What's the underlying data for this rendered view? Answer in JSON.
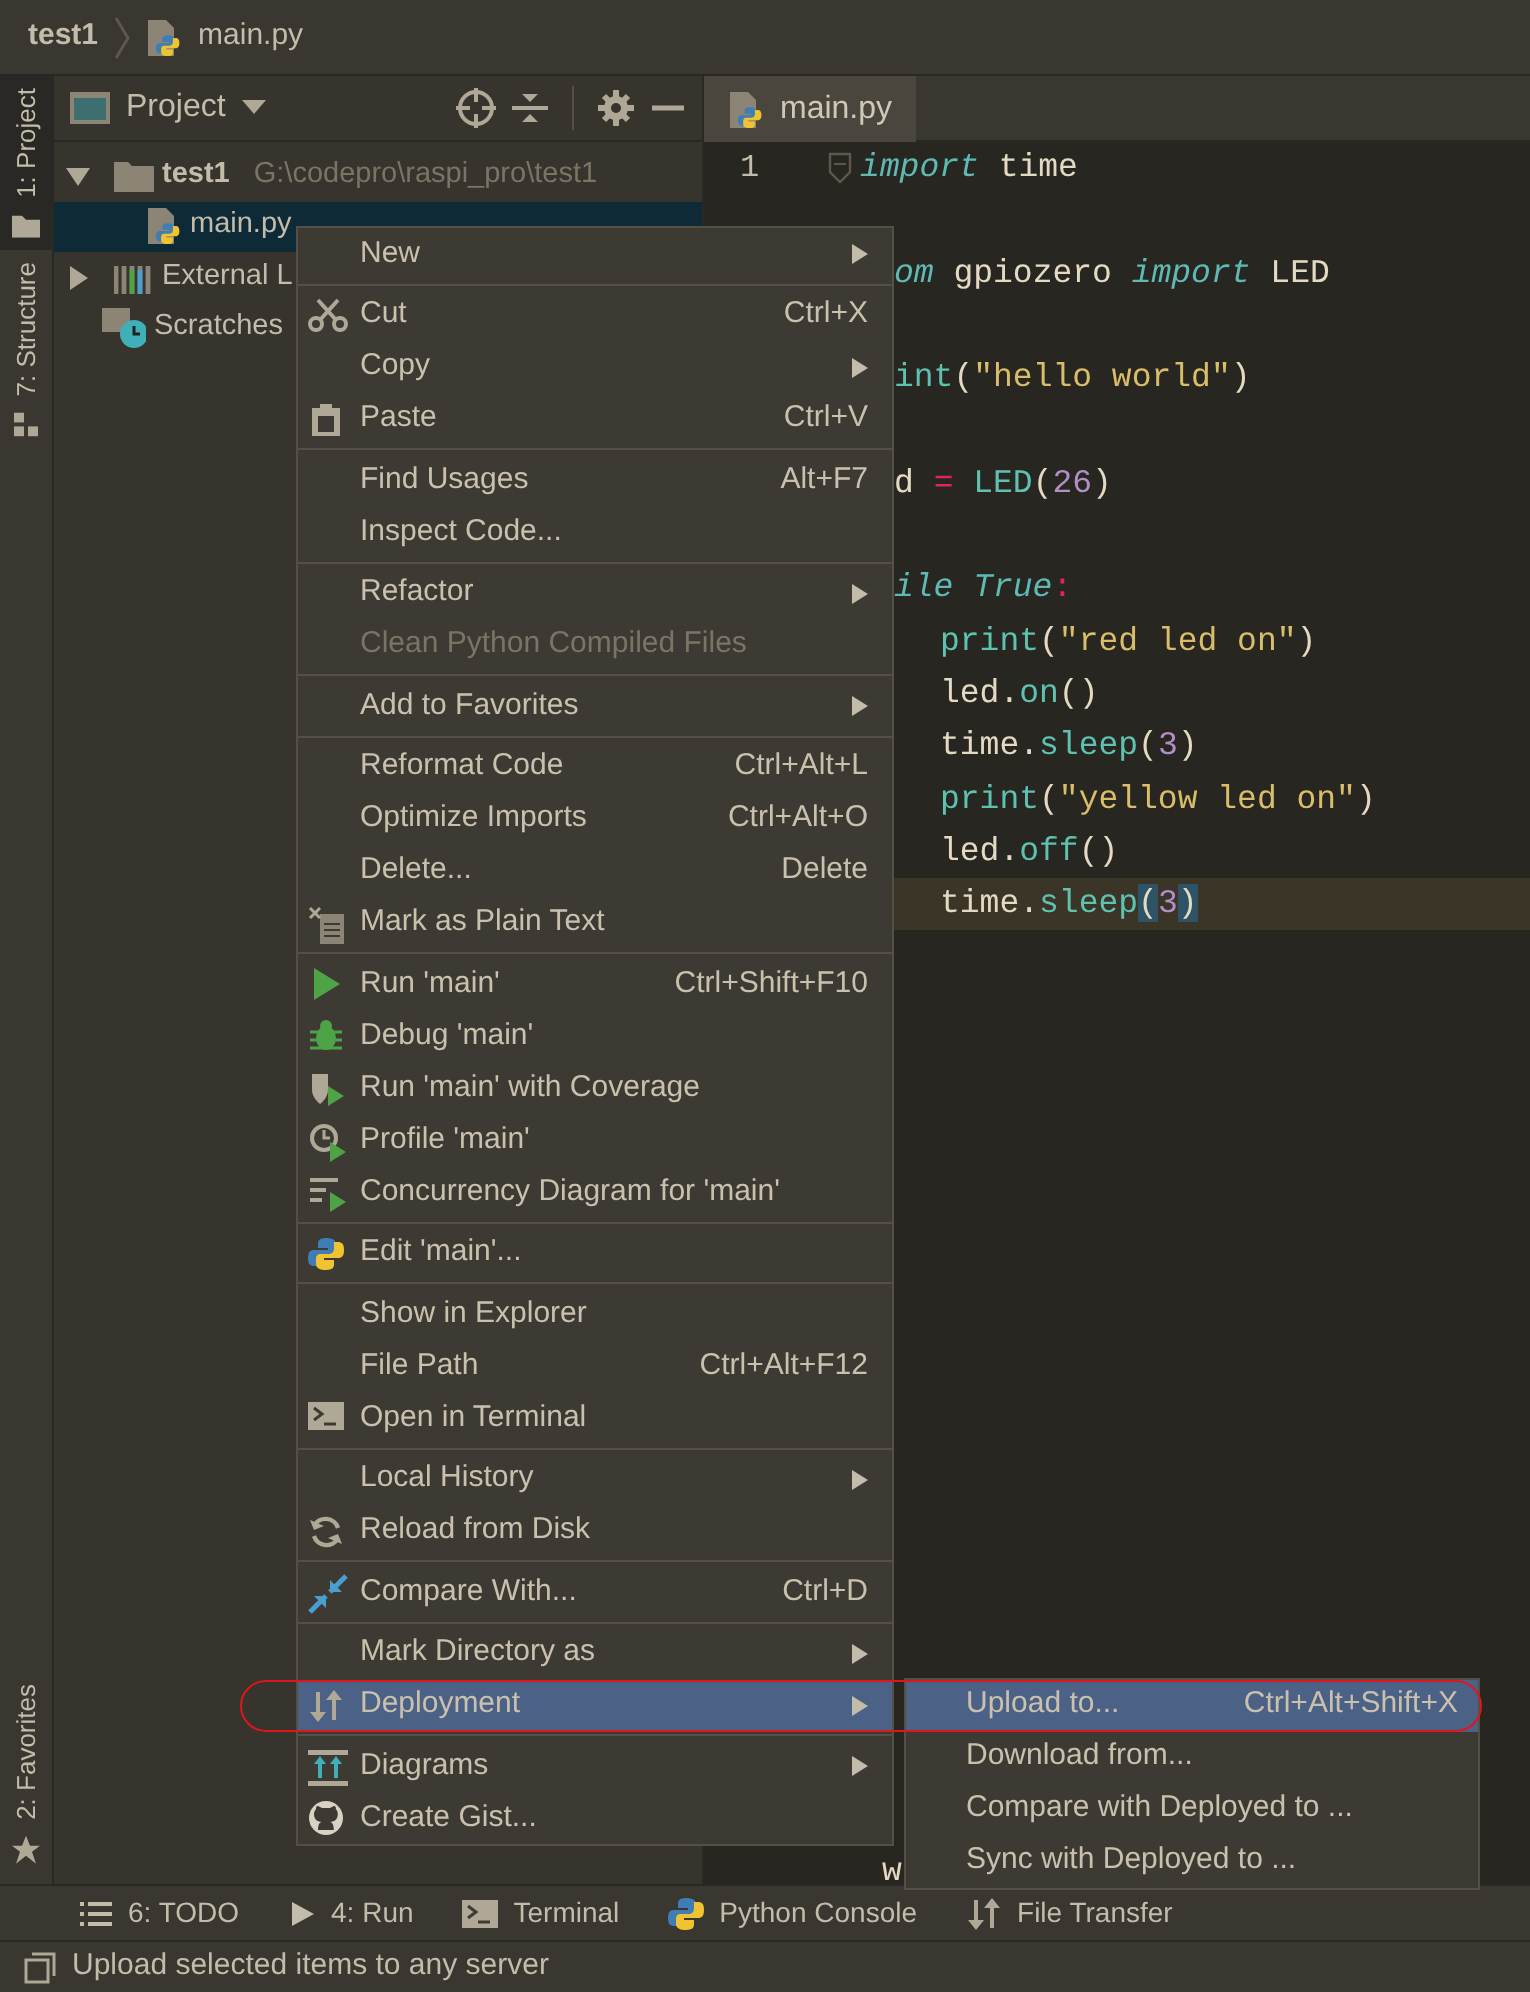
{
  "breadcrumb": {
    "project": "test1",
    "file": "main.py"
  },
  "tool_stripe": {
    "top": [
      {
        "label": "1: Project",
        "kind": "folder",
        "selected": true
      },
      {
        "label": "7: Structure",
        "kind": "structure",
        "selected": false
      }
    ],
    "bottom": [
      {
        "label": "2: Favorites",
        "kind": "star",
        "selected": false
      }
    ]
  },
  "project_panel": {
    "title": "Project",
    "tree": [
      {
        "label": "test1",
        "path": "G:\\codepro\\raspi_pro\\test1",
        "kind": "folder",
        "expanded": true,
        "selected": false,
        "children": [
          {
            "label": "main.py",
            "kind": "python_file",
            "selected": true
          }
        ]
      },
      {
        "label": "External L",
        "kind": "library",
        "expanded": false,
        "selected": false
      },
      {
        "label": "Scratches",
        "kind": "scratches",
        "selected": false
      }
    ]
  },
  "editor": {
    "tabs": [
      {
        "label": "main.py",
        "selected": true
      }
    ],
    "line_numbers": [
      "1"
    ],
    "lines": [
      {
        "kind": "full",
        "current": false,
        "tokens": [
          {
            "text": "import",
            "kind": "kw"
          },
          {
            "text": " time",
            "kind": "plain"
          }
        ]
      },
      {
        "kind": "cut",
        "current": false,
        "tokens": [
          {
            "text": "om",
            "kind": "kw"
          },
          {
            "text": " gpiozero ",
            "kind": "plain"
          },
          {
            "text": "import",
            "kind": "kw"
          },
          {
            "text": " LED",
            "kind": "plain"
          }
        ]
      },
      {
        "kind": "cut",
        "current": false,
        "tokens": [
          {
            "text": "int",
            "kind": "fn"
          },
          {
            "text": "(",
            "kind": "plain"
          },
          {
            "text": "\"hello world\"",
            "kind": "str"
          },
          {
            "text": ")",
            "kind": "plain"
          }
        ]
      },
      {
        "kind": "cut",
        "current": false,
        "tokens": [
          {
            "text": "d ",
            "kind": "plain"
          },
          {
            "text": "=",
            "kind": "op"
          },
          {
            "text": " LED",
            "kind": "fn"
          },
          {
            "text": "(",
            "kind": "plain"
          },
          {
            "text": "26",
            "kind": "num"
          },
          {
            "text": ")",
            "kind": "plain"
          }
        ]
      },
      {
        "kind": "cut",
        "current": false,
        "tokens": [
          {
            "text": "ile True",
            "kind": "kw"
          },
          {
            "text": ":",
            "kind": "op"
          }
        ]
      },
      {
        "kind": "indented",
        "current": false,
        "tokens": [
          {
            "text": "print",
            "kind": "fn"
          },
          {
            "text": "(",
            "kind": "plain"
          },
          {
            "text": "\"red led on\"",
            "kind": "str"
          },
          {
            "text": ")",
            "kind": "plain"
          }
        ]
      },
      {
        "kind": "indented",
        "current": false,
        "tokens": [
          {
            "text": "led.",
            "kind": "plain"
          },
          {
            "text": "on",
            "kind": "fn"
          },
          {
            "text": "()",
            "kind": "plain"
          }
        ]
      },
      {
        "kind": "indented",
        "current": false,
        "tokens": [
          {
            "text": "time.",
            "kind": "plain"
          },
          {
            "text": "sleep",
            "kind": "fn"
          },
          {
            "text": "(",
            "kind": "plain"
          },
          {
            "text": "3",
            "kind": "num"
          },
          {
            "text": ")",
            "kind": "plain"
          }
        ]
      },
      {
        "kind": "indented",
        "current": false,
        "tokens": [
          {
            "text": "print",
            "kind": "fn"
          },
          {
            "text": "(",
            "kind": "plain"
          },
          {
            "text": "\"yellow led on\"",
            "kind": "str"
          },
          {
            "text": ")",
            "kind": "plain"
          }
        ]
      },
      {
        "kind": "indented",
        "current": false,
        "tokens": [
          {
            "text": "led.",
            "kind": "plain"
          },
          {
            "text": "off",
            "kind": "fn"
          },
          {
            "text": "()",
            "kind": "plain"
          }
        ]
      },
      {
        "kind": "indented",
        "current": true,
        "tokens": [
          {
            "text": "time.",
            "kind": "plain"
          },
          {
            "text": "sleep",
            "kind": "fn"
          },
          {
            "text": "(",
            "kind": "match"
          },
          {
            "text": "3",
            "kind": "num"
          },
          {
            "text": ")",
            "kind": "match"
          }
        ]
      },
      {
        "kind": "cut",
        "current": false,
        "tokens": [
          {
            "text": "w",
            "kind": "plain"
          }
        ]
      }
    ]
  },
  "context_menu": {
    "groups": [
      {
        "items": [
          {
            "label": "New",
            "submenu": true,
            "disabled": false,
            "selected": false
          }
        ]
      },
      {
        "items": [
          {
            "label": "Cut",
            "kind": "scissors",
            "shortcut": "Ctrl+X",
            "submenu": false,
            "disabled": false,
            "selected": false
          },
          {
            "label": "Copy",
            "submenu": true,
            "disabled": false,
            "selected": false
          },
          {
            "label": "Paste",
            "kind": "clipboard",
            "shortcut": "Ctrl+V",
            "submenu": false,
            "disabled": false,
            "selected": false
          }
        ]
      },
      {
        "items": [
          {
            "label": "Find Usages",
            "shortcut": "Alt+F7",
            "submenu": false,
            "disabled": false,
            "selected": false
          },
          {
            "label": "Inspect Code...",
            "submenu": false,
            "disabled": false,
            "selected": false
          }
        ]
      },
      {
        "items": [
          {
            "label": "Refactor",
            "submenu": true,
            "disabled": false,
            "selected": false
          },
          {
            "label": "Clean Python Compiled Files",
            "submenu": false,
            "disabled": true,
            "selected": false
          }
        ]
      },
      {
        "items": [
          {
            "label": "Add to Favorites",
            "submenu": true,
            "disabled": false,
            "selected": false
          }
        ]
      },
      {
        "items": [
          {
            "label": "Reformat Code",
            "shortcut": "Ctrl+Alt+L",
            "submenu": false,
            "disabled": false,
            "selected": false
          },
          {
            "label": "Optimize Imports",
            "shortcut": "Ctrl+Alt+O",
            "submenu": false,
            "disabled": false,
            "selected": false
          },
          {
            "label": "Delete...",
            "shortcut": "Delete",
            "submenu": false,
            "disabled": false,
            "selected": false
          },
          {
            "label": "Mark as Plain Text",
            "kind": "document",
            "submenu": false,
            "disabled": false,
            "selected": false
          }
        ]
      },
      {
        "items": [
          {
            "label": "Run 'main'",
            "kind": "run",
            "shortcut": "Ctrl+Shift+F10",
            "submenu": false,
            "disabled": false,
            "selected": false
          },
          {
            "label": "Debug 'main'",
            "kind": "bug",
            "submenu": false,
            "disabled": false,
            "selected": false
          },
          {
            "label": "Run 'main' with Coverage",
            "kind": "coverage",
            "submenu": false,
            "disabled": false,
            "selected": false
          },
          {
            "label": "Profile 'main'",
            "kind": "profile",
            "submenu": false,
            "disabled": false,
            "selected": false
          },
          {
            "label": "Concurrency Diagram for 'main'",
            "kind": "concurrency",
            "submenu": false,
            "disabled": false,
            "selected": false
          }
        ]
      },
      {
        "items": [
          {
            "label": "Edit 'main'...",
            "kind": "python",
            "submenu": false,
            "disabled": false,
            "selected": false
          }
        ]
      },
      {
        "items": [
          {
            "label": "Show in Explorer",
            "submenu": false,
            "disabled": false,
            "selected": false
          },
          {
            "label": "File Path",
            "shortcut": "Ctrl+Alt+F12",
            "submenu": false,
            "disabled": false,
            "selected": false
          },
          {
            "label": "Open in Terminal",
            "kind": "terminal",
            "submenu": false,
            "disabled": false,
            "selected": false
          }
        ]
      },
      {
        "items": [
          {
            "label": "Local History",
            "submenu": true,
            "disabled": false,
            "selected": false
          },
          {
            "label": "Reload from Disk",
            "kind": "reload",
            "submenu": false,
            "disabled": false,
            "selected": false
          }
        ]
      },
      {
        "items": [
          {
            "label": "Compare With...",
            "kind": "compare",
            "shortcut": "Ctrl+D",
            "submenu": false,
            "disabled": false,
            "selected": false
          }
        ]
      },
      {
        "items": [
          {
            "label": "Mark Directory as",
            "submenu": true,
            "disabled": false,
            "selected": false
          },
          {
            "label": "Deployment",
            "kind": "transfer",
            "submenu": true,
            "disabled": false,
            "selected": true
          }
        ]
      },
      {
        "items": [
          {
            "label": "Diagrams",
            "kind": "diagram",
            "submenu": true,
            "disabled": false,
            "selected": false
          },
          {
            "label": "Create Gist...",
            "kind": "gist",
            "submenu": false,
            "disabled": false,
            "selected": false
          }
        ]
      }
    ]
  },
  "submenu": {
    "items": [
      {
        "label": "Upload to...",
        "shortcut": "Ctrl+Alt+Shift+X",
        "selected": true
      },
      {
        "label": "Download from...",
        "selected": false
      },
      {
        "label": "Compare with Deployed to ...",
        "selected": false
      },
      {
        "label": "Sync with Deployed to ...",
        "selected": false
      }
    ]
  },
  "annotation": {
    "kind": "outline"
  },
  "bottom_tools": [
    {
      "label": "6: TODO",
      "kind": "list"
    },
    {
      "label": "4: Run",
      "kind": "play"
    },
    {
      "label": "Terminal",
      "kind": "terminal"
    },
    {
      "label": "Python Console",
      "kind": "python"
    },
    {
      "label": "File Transfer",
      "kind": "transfer"
    }
  ],
  "status_bar": {
    "message": "Upload selected items to any server"
  }
}
